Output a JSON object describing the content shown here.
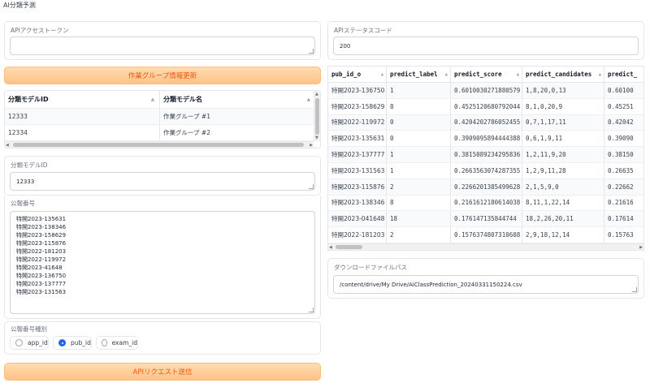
{
  "app": {
    "title": "AI分類予測"
  },
  "access_token": {
    "label": "APIアクセストークン",
    "value": ""
  },
  "fetch_button": {
    "label": "作業グループ情報更新"
  },
  "group_table": {
    "columns": [
      "分類モデルID",
      "分類モデル名"
    ],
    "rows": [
      [
        "12333",
        "作業グループ #1"
      ],
      [
        "12334",
        "作業グループ #2"
      ]
    ]
  },
  "model_id": {
    "label": "分類モデルID",
    "value": "12333"
  },
  "pub_numbers": {
    "label": "公報番号",
    "value": "特開2023-135631\n特開2023-138346\n特開2023-158629\n特開2023-115876\n特開2022-181203\n特開2022-119972\n特開2023-41648\n特開2023-136750\n特開2023-137777\n特開2023-131563"
  },
  "id_type": {
    "label": "公報番号種別",
    "options": [
      "app_id",
      "pub_id",
      "exam_id"
    ],
    "selected": "pub_id"
  },
  "submit_button": {
    "label": "APIリクエスト送信"
  },
  "status_code": {
    "label": "APIステータスコード",
    "value": "200"
  },
  "result_table": {
    "columns": [
      "pub_id_o",
      "predict_label",
      "predict_score",
      "predict_candidates",
      "predict_"
    ],
    "rows": [
      [
        "特開2023-136750",
        "1",
        "0.6010030271880579",
        "1,8,20,0,13",
        "0.60100"
      ],
      [
        "特開2023-158629",
        "8",
        "0.4525120680792044",
        "8,1,0,20,9",
        "0.45251"
      ],
      [
        "特開2022-119972",
        "0",
        "0.4204202786052455",
        "0,7,1,17,11",
        "0.42042"
      ],
      [
        "特開2023-135631",
        "0",
        "0.3909095894444388",
        "0,6,1,9,11",
        "0.39090"
      ],
      [
        "特開2023-137777",
        "1",
        "0.3815089234295836",
        "1,2,11,9,20",
        "0.38150"
      ],
      [
        "特開2023-131563",
        "1",
        "0.2663563074287355",
        "1,2,9,11,28",
        "0.26635"
      ],
      [
        "特開2023-115876",
        "2",
        "0.2266201385499628",
        "2,1,5,9,0",
        "0.22662"
      ],
      [
        "特開2023-138346",
        "8",
        "0.2161612180614038",
        "8,11,1,22,14",
        "0.21616"
      ],
      [
        "特開2023-041648",
        "18",
        "0.176147135844744",
        "18,2,26,20,11",
        "0.17614"
      ],
      [
        "特開2022-181203",
        "2",
        "0.1576374807310608",
        "2,9,18,12,14",
        "0.15763"
      ]
    ]
  },
  "download_path": {
    "label": "ダウンロードファイルパス",
    "value": "/content/drive/My Drive/AiClassPrediction_20240331150224.csv"
  },
  "icons": {
    "sort": "sort-arrows-icon",
    "radio": "radio-icon"
  },
  "colors": {
    "accent": "#ea580c",
    "button_bg": "#ffc286",
    "radio_selected": "#2563eb"
  }
}
